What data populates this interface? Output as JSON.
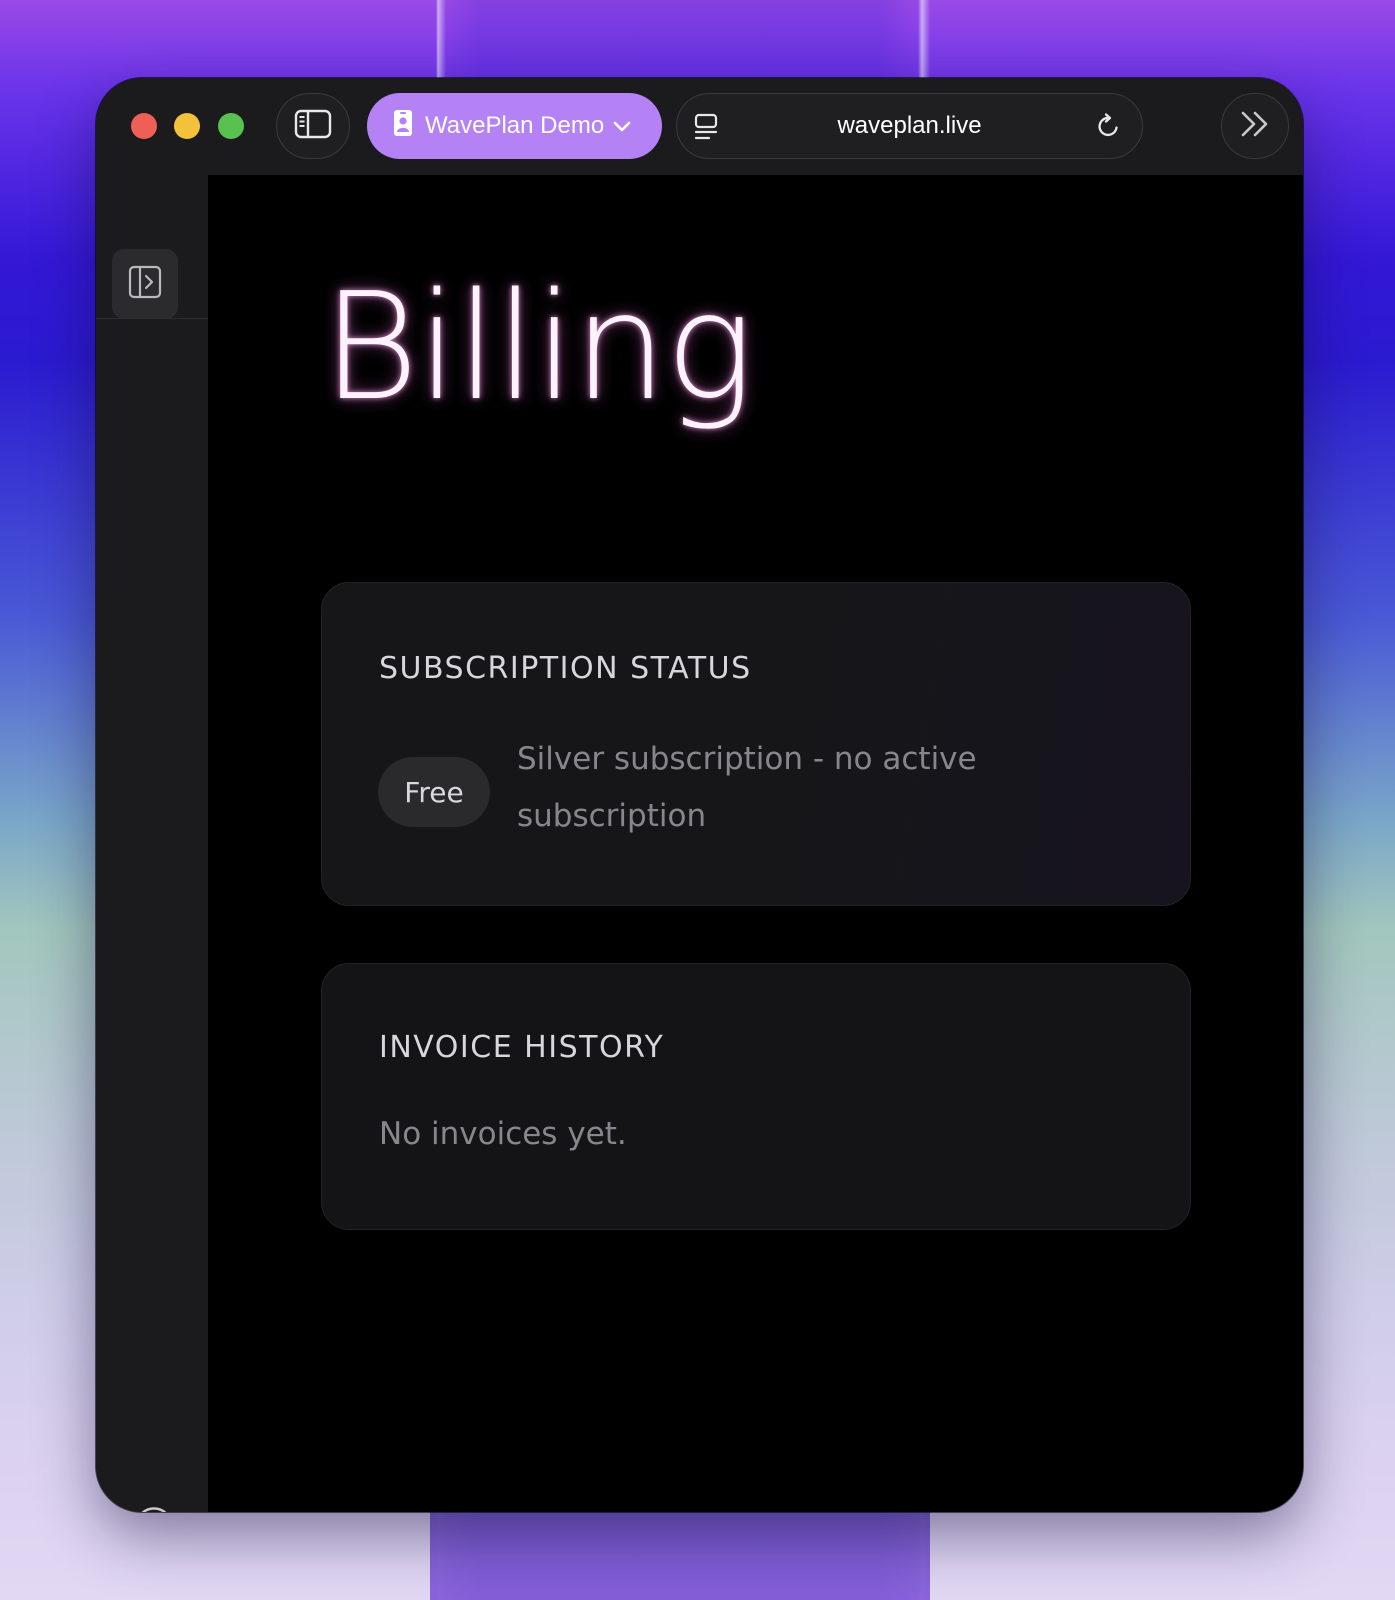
{
  "browser": {
    "profile_label": "WavePlan Demo",
    "url": "waveplan.live"
  },
  "icons": {
    "sidebar_toggle": "sidebar-icon",
    "profile": "id-badge-icon",
    "profile_chevron": "chevron-down-icon",
    "site_settings": "page-settings-icon",
    "reload": "reload-icon",
    "more": "double-chevron-right-icon",
    "rail_toggle": "expand-sidebar-icon",
    "help": "help-circle-icon"
  },
  "page": {
    "title": "Billing"
  },
  "subscription": {
    "heading": "SUBSCRIPTION STATUS",
    "badge": "Free",
    "description": "Silver subscription - no active subscription"
  },
  "invoices": {
    "heading": "INVOICE HISTORY",
    "empty_text": "No invoices yet."
  },
  "colors": {
    "profile_accent": "#b582f5",
    "title_glow": "#e48bd8",
    "close": "#ed5f57",
    "minimize": "#f3c13a",
    "zoom": "#58c150"
  }
}
